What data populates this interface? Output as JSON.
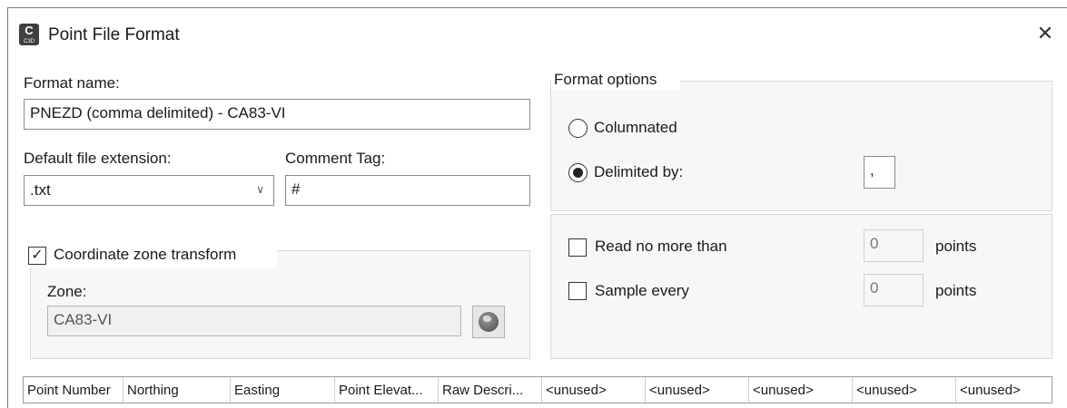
{
  "window": {
    "title": "Point File Format",
    "app_icon_letter": "C",
    "app_icon_sub": "C3D",
    "close_glyph": "✕"
  },
  "form": {
    "format_name_label": "Format name:",
    "format_name_value": "PNEZD (comma delimited) - CA83-VI",
    "default_ext_label": "Default file extension:",
    "default_ext_value": ".txt",
    "comment_tag_label": "Comment Tag:",
    "comment_tag_value": "#",
    "coord_transform_label": "Coordinate zone transform",
    "coord_transform_checked": true,
    "zone_label": "Zone:",
    "zone_value": "CA83-VI"
  },
  "format_options": {
    "group_label": "Format options",
    "columnated_label": "Columnated",
    "columnated_selected": false,
    "delimited_label": "Delimited by:",
    "delimited_selected": true,
    "delimiter_value": ",",
    "read_no_more_label": "Read no more than",
    "read_no_more_value": "0",
    "read_no_more_unit": "points",
    "sample_every_label": "Sample every",
    "sample_every_value": "0",
    "sample_every_unit": "points"
  },
  "columns": [
    "Point Number",
    "Northing",
    "Easting",
    "Point Elevat...",
    "Raw Descri...",
    "<unused>",
    "<unused>",
    "<unused>",
    "<unused>",
    "<unused>"
  ],
  "icons": {
    "app": "c3d-app-icon",
    "close": "close-icon",
    "globe": "globe-icon",
    "dropdown": "chevron-down-icon"
  }
}
